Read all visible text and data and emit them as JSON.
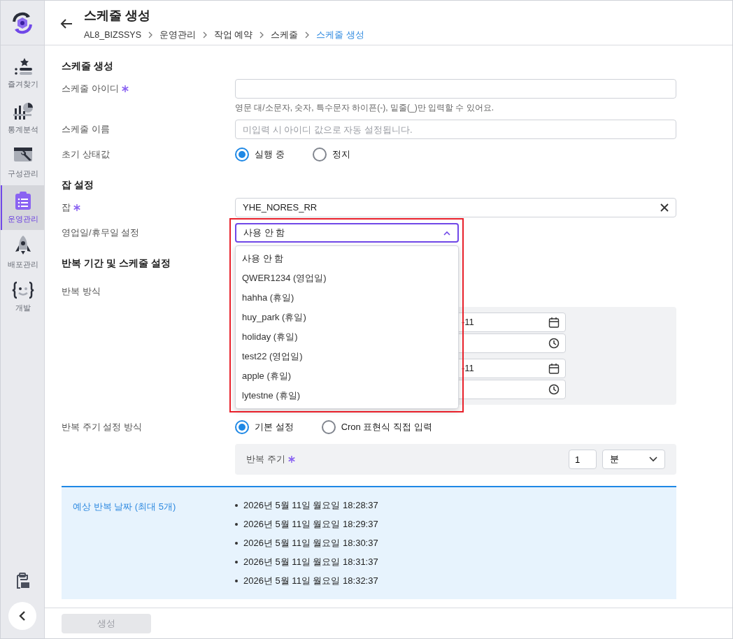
{
  "sidebar": {
    "items": [
      {
        "label": "즐겨찾기",
        "selected": false
      },
      {
        "label": "통계분석",
        "selected": false
      },
      {
        "label": "구성관리",
        "selected": false
      },
      {
        "label": "운영관리",
        "selected": true
      },
      {
        "label": "배포관리",
        "selected": false
      },
      {
        "label": "개발",
        "selected": false
      }
    ]
  },
  "header": {
    "title": "스케줄 생성",
    "breadcrumb": [
      {
        "label": "AL8_BIZSSYS",
        "current": false
      },
      {
        "label": "운영관리",
        "current": false
      },
      {
        "label": "작업 예약",
        "current": false
      },
      {
        "label": "스케줄",
        "current": false
      },
      {
        "label": "스케줄 생성",
        "current": true
      }
    ]
  },
  "sections": [
    {
      "title": "스케줄 생성",
      "fields": [
        {
          "kind": "text",
          "label": "스케줄 아이디",
          "required": true,
          "help": "영문 대/소문자, 숫자, 특수문자 하이픈(-), 밑줄(_)만 입력할 수 있어요."
        },
        {
          "kind": "text",
          "label": "스케줄 이름",
          "required": false,
          "placeholder": "미입력 시 아이디 값으로 자동 설정됩니다."
        },
        {
          "kind": "radio",
          "label": "초기 상태값",
          "required": false,
          "options": [
            {
              "label": "실행 중",
              "selected": true
            },
            {
              "label": "정지",
              "selected": false
            }
          ]
        }
      ]
    },
    {
      "title": "잡 설정",
      "fields": [
        {
          "kind": "clearable",
          "label": "잡",
          "required": true,
          "value": "YHE_NORES_RR"
        },
        {
          "kind": "select",
          "label": "영업일/휴무일 설정",
          "required": false,
          "value": "사용 안 함",
          "expanded": true,
          "options": [
            {
              "label": "사용 안 함",
              "selected": true
            },
            {
              "label": "QWER1234 (영업일)",
              "selected": false
            },
            {
              "label": "hahha (휴일)",
              "selected": false
            },
            {
              "label": "huy_park (휴일)",
              "selected": false
            },
            {
              "label": "holiday (휴일)",
              "selected": false
            },
            {
              "label": "test22 (영업일)",
              "selected": false
            },
            {
              "label": "apple (휴일)",
              "selected": false
            },
            {
              "label": "lytestne (휴일)",
              "selected": false
            }
          ]
        }
      ]
    },
    {
      "title": "반복 기간 및 스케줄 설정",
      "fields": [
        {
          "kind": "range",
          "label": "반복 방식",
          "required": false,
          "inputs": [
            {
              "kind": "date",
              "value": "-11"
            },
            {
              "kind": "time"
            },
            {
              "kind": "date",
              "value": "-11"
            },
            {
              "kind": "time"
            }
          ]
        },
        {
          "kind": "radio",
          "label": "반복 주기 설정 방식",
          "required": false,
          "options": [
            {
              "label": "기본 설정",
              "selected": true
            },
            {
              "label": "Cron 표현식 직접 입력",
              "selected": false
            }
          ],
          "panel": {
            "label": "반복 주기",
            "required": true,
            "value": "1",
            "unit": "분"
          }
        }
      ]
    }
  ],
  "preview": {
    "title": "예상 반복 날짜 (최대 5개)",
    "dates": [
      "2026년 5월 11일 월요일 18:28:37",
      "2026년 5월 11일 월요일 18:29:37",
      "2026년 5월 11일 월요일 18:30:37",
      "2026년 5월 11일 월요일 18:31:37",
      "2026년 5월 11일 월요일 18:32:37"
    ]
  },
  "footer": {
    "submit": {
      "label": "생성",
      "disabled": true
    }
  }
}
